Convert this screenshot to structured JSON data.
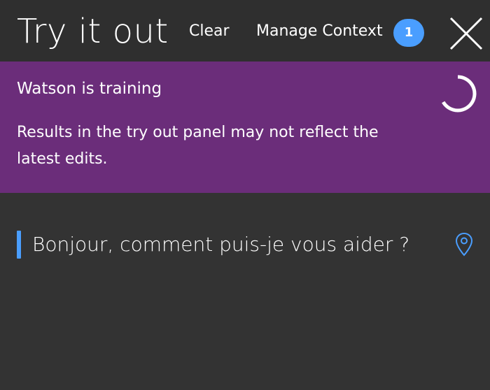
{
  "header": {
    "title": "Try it out",
    "clear_label": "Clear",
    "manage_context_label": "Manage Context",
    "context_count": "1",
    "close_icon": "close-icon"
  },
  "banner": {
    "title": "Watson is training",
    "text": "Results in the try out panel may not reflect the latest edits.",
    "spinner_icon": "spinner-icon"
  },
  "conversation": {
    "messages": [
      {
        "text": "Bonjour, comment puis-je vous aider ?",
        "icon": "location-pin-icon"
      }
    ]
  },
  "colors": {
    "background": "#333333",
    "header_background": "#2f2f2f",
    "banner_background": "#6b2d7a",
    "accent": "#4a9eff",
    "text": "#ffffff"
  }
}
